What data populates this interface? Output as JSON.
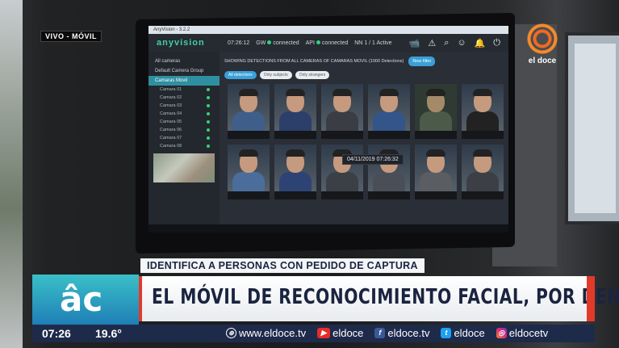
{
  "broadcast": {
    "live_tag": "VIVO - MÓVIL",
    "channel_name": "el doce",
    "subheadline": "IDENTIFICA A PERSONAS CON PEDIDO DE CAPTURA",
    "headline": "EL MÓVIL DE RECONOCIMIENTO FACIAL, POR DENTRO",
    "logo_text": "âc",
    "time": "07:26",
    "temperature": "19.6°",
    "socials": [
      {
        "icon": "globe-icon",
        "label": "www.eldoce.tv"
      },
      {
        "icon": "youtube-icon",
        "label": "eldoce"
      },
      {
        "icon": "facebook-icon",
        "label": "eldoce.tv"
      },
      {
        "icon": "twitter-icon",
        "label": "eldoce"
      },
      {
        "icon": "instagram-icon",
        "label": "eldocetv"
      }
    ],
    "colors": {
      "accent_red": "#e23a2a",
      "ticker_bg": "#1e2a4a",
      "brand_orange": "#f26a21"
    }
  },
  "app": {
    "window_title": "AnyVision - 3.2.2",
    "logo": "anyvision",
    "clock": "07:26:12",
    "status": {
      "gw_label": "GW",
      "gw_value": "connected",
      "api_label": "API",
      "api_value": "connected",
      "nn_label": "NN",
      "nn_value": "1 / 1 Active"
    },
    "sidebar": {
      "all_cameras": "All cameras",
      "group": "Default Camera Group",
      "active_item": "Camaras Movil",
      "cameras": [
        "Camara 01",
        "Camara 02",
        "Camara 03",
        "Camara 04",
        "Camara 05",
        "Camara 06",
        "Camara 07",
        "Camara 08"
      ]
    },
    "content": {
      "banner": "SHOWING DETECTIONS FROM ALL CAMERAS OF CAMARAS MOVIL (1000 Detections)",
      "new_button": "New filter",
      "filters": [
        "All detections",
        "Only subjects",
        "Only strangers"
      ],
      "timestamp": "04/11/2019 07:26:32"
    }
  }
}
